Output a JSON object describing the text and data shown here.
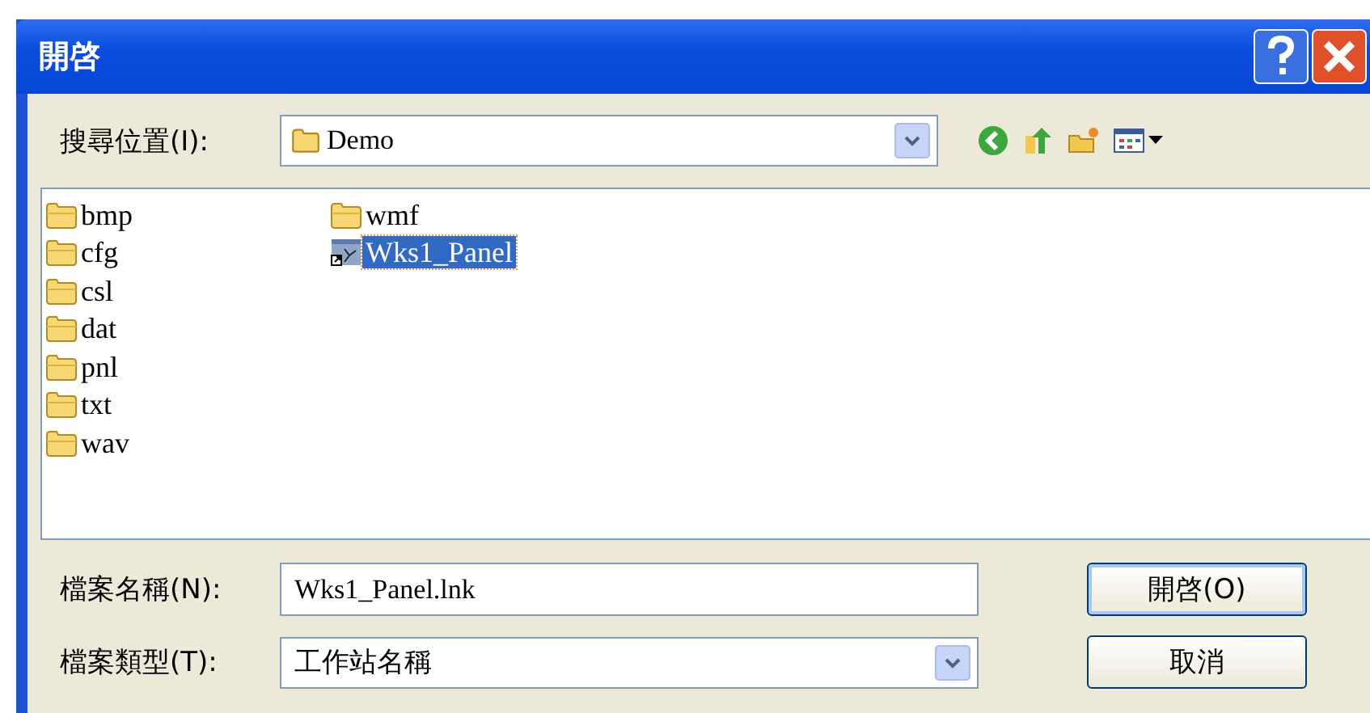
{
  "window": {
    "title": "開啓"
  },
  "look_in": {
    "label": "搜尋位置(I):",
    "value": "Demo"
  },
  "files": [
    {
      "name": "bmp",
      "kind": "folder",
      "selected": false
    },
    {
      "name": "cfg",
      "kind": "folder",
      "selected": false
    },
    {
      "name": "csl",
      "kind": "folder",
      "selected": false
    },
    {
      "name": "dat",
      "kind": "folder",
      "selected": false
    },
    {
      "name": "pnl",
      "kind": "folder",
      "selected": false
    },
    {
      "name": "txt",
      "kind": "folder",
      "selected": false
    },
    {
      "name": "wav",
      "kind": "folder",
      "selected": false
    },
    {
      "name": "wmf",
      "kind": "folder",
      "selected": false
    },
    {
      "name": "Wks1_Panel",
      "kind": "shortcut",
      "selected": true
    }
  ],
  "file_name": {
    "label": "檔案名稱(N):",
    "value": "Wks1_Panel.lnk"
  },
  "file_type": {
    "label": "檔案類型(T):",
    "value": "工作站名稱"
  },
  "buttons": [
    "開啓(O)",
    "取消"
  ]
}
